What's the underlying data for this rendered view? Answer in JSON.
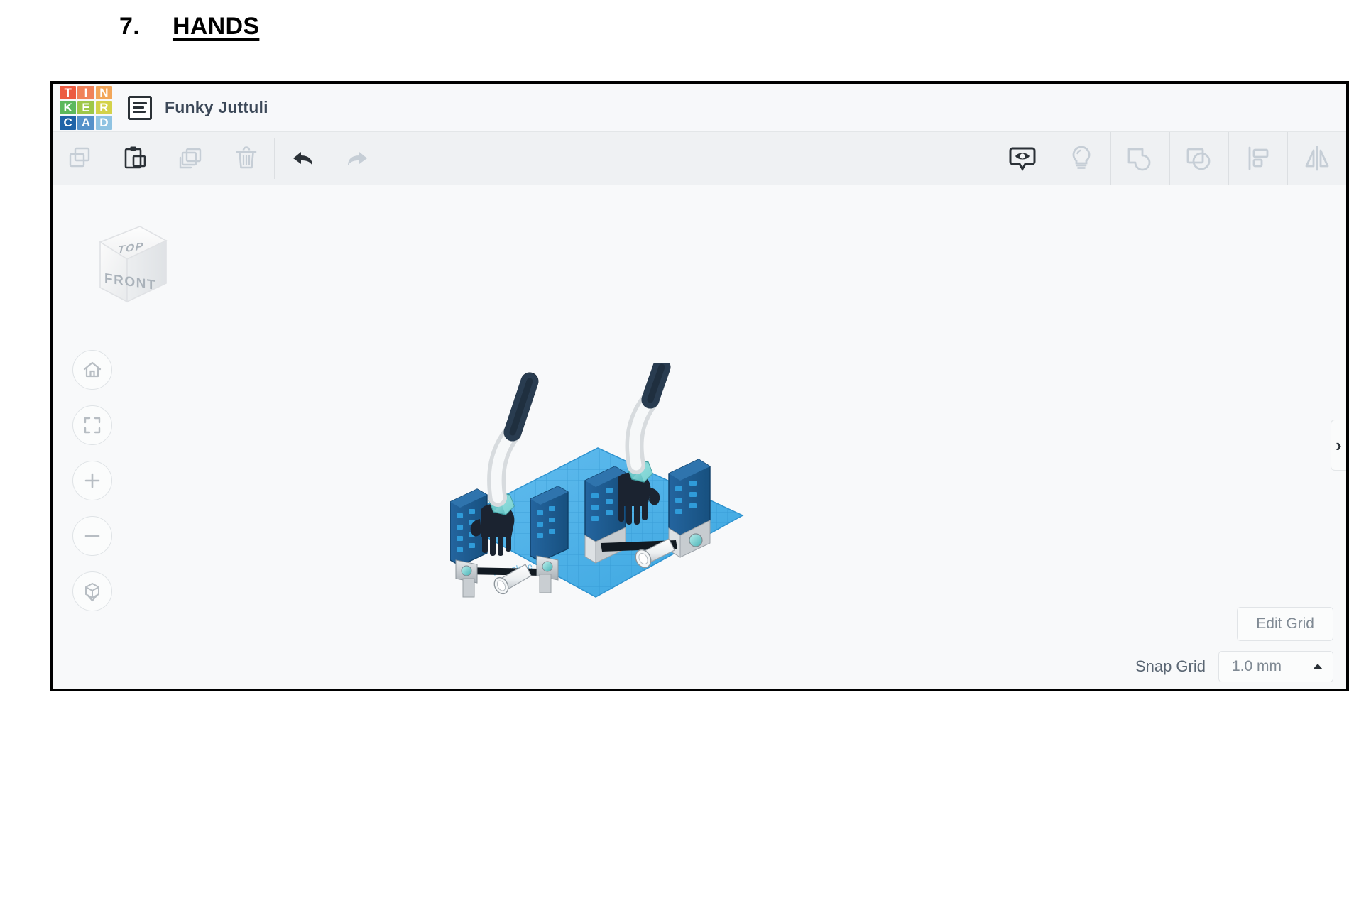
{
  "document": {
    "section_number": "7.",
    "section_title": "HANDS"
  },
  "app": {
    "name": "Tinkercad",
    "logo_tiles": [
      {
        "letter": "T",
        "color": "#ec5b41"
      },
      {
        "letter": "I",
        "color": "#f0825a"
      },
      {
        "letter": "N",
        "color": "#f2a65a"
      },
      {
        "letter": "K",
        "color": "#5db85c"
      },
      {
        "letter": "E",
        "color": "#9ec748"
      },
      {
        "letter": "R",
        "color": "#d4d24a"
      },
      {
        "letter": "C",
        "color": "#1f63a8"
      },
      {
        "letter": "A",
        "color": "#5591c9"
      },
      {
        "letter": "D",
        "color": "#8fc3e2"
      }
    ],
    "design_name": "Funky Juttuli",
    "doc_icon": "document-list-icon"
  },
  "toolbar": {
    "left_tools": [
      {
        "name": "copy-icon",
        "label": "Copy",
        "enabled": false
      },
      {
        "name": "paste-icon",
        "label": "Paste",
        "enabled": true
      },
      {
        "name": "duplicate-icon",
        "label": "Duplicate",
        "enabled": false
      },
      {
        "name": "delete-icon",
        "label": "Delete",
        "enabled": false
      }
    ],
    "history_tools": [
      {
        "name": "undo-icon",
        "label": "Undo",
        "enabled": true
      },
      {
        "name": "redo-icon",
        "label": "Redo",
        "enabled": false
      }
    ],
    "right_tools": [
      {
        "name": "show-hide-icon",
        "label": "Show/Hide",
        "enabled": true
      },
      {
        "name": "lightbulb-icon",
        "label": "Notes",
        "enabled": false
      },
      {
        "name": "group-icon",
        "label": "Group",
        "enabled": false
      },
      {
        "name": "ungroup-icon",
        "label": "Ungroup",
        "enabled": false
      },
      {
        "name": "align-icon",
        "label": "Align",
        "enabled": false
      },
      {
        "name": "mirror-icon",
        "label": "Mirror",
        "enabled": false
      }
    ]
  },
  "viewport": {
    "viewcube": {
      "top_face": "TOP",
      "front_face": "FRONT"
    },
    "nav_buttons": [
      {
        "name": "home-view-button",
        "label": "Home view"
      },
      {
        "name": "fit-to-view-button",
        "label": "Fit all in view"
      },
      {
        "name": "zoom-in-button",
        "label": "Zoom in"
      },
      {
        "name": "zoom-out-button",
        "label": "Zoom out"
      },
      {
        "name": "ortho-perspective-button",
        "label": "Switch to orthographic/perspective view"
      }
    ],
    "flyout_handle": "›",
    "workplane_watermark": "Workplane"
  },
  "grid_controls": {
    "edit_grid_label": "Edit Grid",
    "snap_grid_label": "Snap Grid",
    "snap_grid_value": "1.0 mm",
    "snap_caret": "caret-up-icon"
  },
  "colors": {
    "workplane_blue": "#4fb3e8",
    "workplane_grid": "#2c8fcb",
    "panel_blue": "#1b5f9e",
    "panel_dot": "#2f9bd9",
    "tube_dark": "#1b2734",
    "pipe_white": "#e9ecee",
    "gem_teal": "#6fd0cf",
    "metal_grey": "#b9bfc4",
    "header_bg": "#f7f8fa",
    "toolbar_bg": "#eff1f3",
    "canvas_bg": "#f8f9fa",
    "icon_disabled": "#c6ced6",
    "icon_enabled": "#2b3137",
    "title_text": "#3c4858"
  }
}
